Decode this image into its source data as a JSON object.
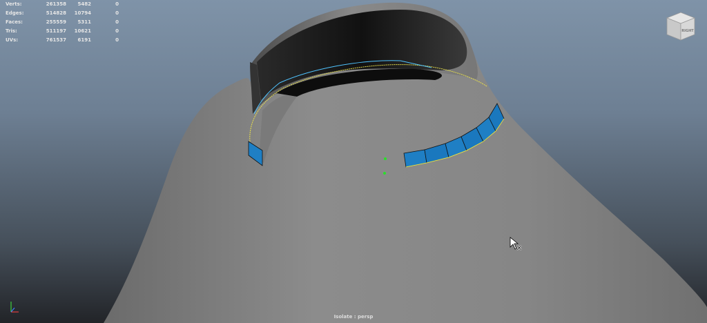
{
  "hud": {
    "rows": [
      {
        "label": "Verts:",
        "total": "261358",
        "selected": "5482",
        "highlighted": "0"
      },
      {
        "label": "Edges:",
        "total": "514828",
        "selected": "10794",
        "highlighted": "0"
      },
      {
        "label": "Faces:",
        "total": "255559",
        "selected": "5311",
        "highlighted": "0"
      },
      {
        "label": "Tris:",
        "total": "511197",
        "selected": "10621",
        "highlighted": "0"
      },
      {
        "label": "UVs:",
        "total": "761537",
        "selected": "6191",
        "highlighted": "0"
      }
    ]
  },
  "viewcube": {
    "face_label": "RIGHT"
  },
  "viewport": {
    "status_label": "Isolate : persp"
  },
  "colors": {
    "background_top": "#7f93a8",
    "mesh": "#8a8a8a",
    "selection_face": "#1f7fc4",
    "edge_highlight": "#4fc3ff",
    "seam_line": "#e8e04a",
    "pivot": "#2adf2a"
  },
  "icons": {
    "axis_gizmo": "xyz-axis-icon",
    "cursor": "move-cursor-icon",
    "viewcube": "viewcube-icon"
  }
}
